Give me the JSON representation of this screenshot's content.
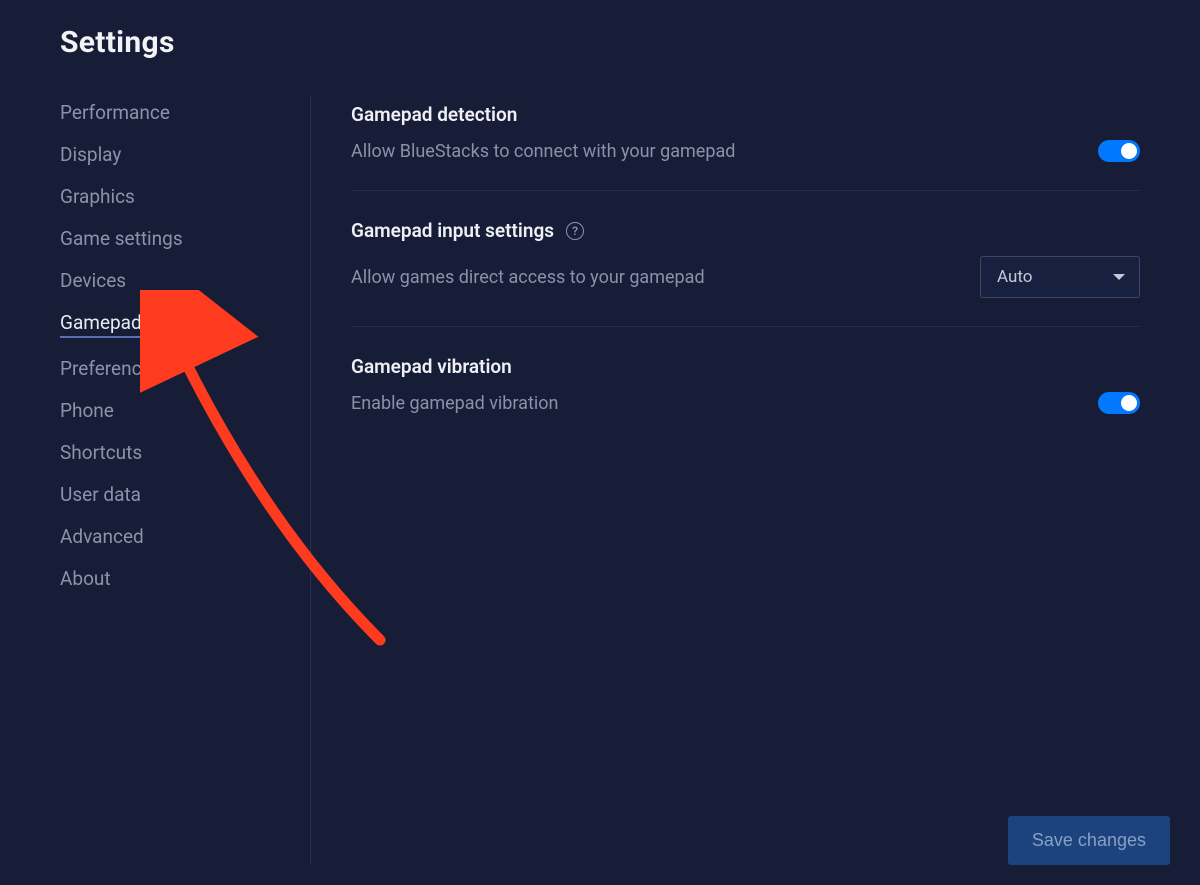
{
  "page_title": "Settings",
  "sidebar": {
    "items": [
      {
        "label": "Performance",
        "active": false
      },
      {
        "label": "Display",
        "active": false
      },
      {
        "label": "Graphics",
        "active": false
      },
      {
        "label": "Game settings",
        "active": false
      },
      {
        "label": "Devices",
        "active": false
      },
      {
        "label": "Gamepad",
        "active": true
      },
      {
        "label": "Preferences",
        "active": false
      },
      {
        "label": "Phone",
        "active": false
      },
      {
        "label": "Shortcuts",
        "active": false
      },
      {
        "label": "User data",
        "active": false
      },
      {
        "label": "Advanced",
        "active": false
      },
      {
        "label": "About",
        "active": false
      }
    ]
  },
  "sections": {
    "detection": {
      "title": "Gamepad detection",
      "description": "Allow BlueStacks to connect with your gamepad",
      "toggle_on": true
    },
    "input": {
      "title": "Gamepad input settings",
      "description": "Allow games direct access to your gamepad",
      "selected": "Auto"
    },
    "vibration": {
      "title": "Gamepad vibration",
      "description": "Enable gamepad vibration",
      "toggle_on": true
    }
  },
  "footer": {
    "save_label": "Save changes"
  }
}
